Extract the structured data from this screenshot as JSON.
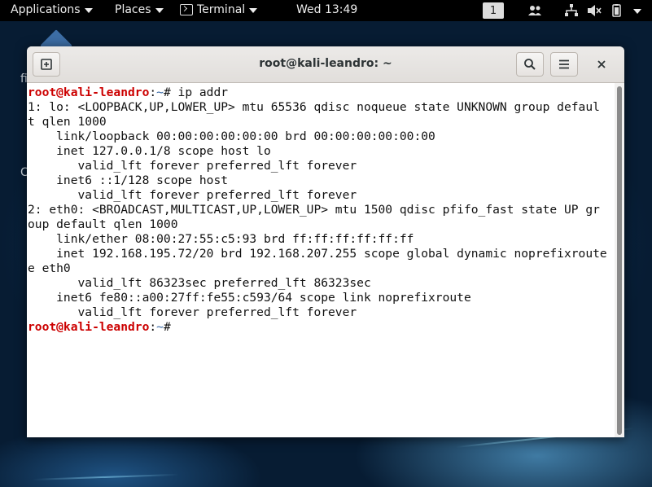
{
  "topbar": {
    "applications_label": "Applications",
    "places_label": "Places",
    "terminal_label": "Terminal",
    "clock": "Wed 13:49",
    "workspace_number": "1"
  },
  "window": {
    "title": "root@kali-leandro: ~"
  },
  "desktop": {
    "partial_text_1": "fi",
    "partial_text_2": "C"
  },
  "terminal": {
    "lines": [
      {
        "user": "root@kali-leandro",
        "sep": ":",
        "path": "~",
        "rest": "# ip addr"
      },
      {
        "text": "1: lo: <LOOPBACK,UP,LOWER_UP> mtu 65536 qdisc noqueue state UNKNOWN group defaul"
      },
      {
        "text": "t qlen 1000"
      },
      {
        "text": "    link/loopback 00:00:00:00:00:00 brd 00:00:00:00:00:00"
      },
      {
        "text": "    inet 127.0.0.1/8 scope host lo"
      },
      {
        "text": "       valid_lft forever preferred_lft forever"
      },
      {
        "text": "    inet6 ::1/128 scope host"
      },
      {
        "text": "       valid_lft forever preferred_lft forever"
      },
      {
        "text": "2: eth0: <BROADCAST,MULTICAST,UP,LOWER_UP> mtu 1500 qdisc pfifo_fast state UP gr"
      },
      {
        "text": "oup default qlen 1000"
      },
      {
        "text": "    link/ether 08:00:27:55:c5:93 brd ff:ff:ff:ff:ff:ff"
      },
      {
        "text": "    inet 192.168.195.72/20 brd 192.168.207.255 scope global dynamic noprefixroute"
      },
      {
        "text": "e eth0"
      },
      {
        "text": "       valid_lft 86323sec preferred_lft 86323sec"
      },
      {
        "text": "    inet6 fe80::a00:27ff:fe55:c593/64 scope link noprefixroute"
      },
      {
        "text": "       valid_lft forever preferred_lft forever"
      },
      {
        "user": "root@kali-leandro",
        "sep": ":",
        "path": "~",
        "rest": "#"
      }
    ]
  },
  "colors": {
    "prompt_user": "#cc0000",
    "prompt_path": "#3465a4",
    "topbar_bg": "#000000",
    "terminal_bg": "#ffffff"
  },
  "icons": {
    "new_tab": "new-tab-icon",
    "search": "search-icon",
    "menu": "hamburger-menu-icon",
    "close": "close-icon",
    "network": "network-icon",
    "volume": "volume-muted-icon",
    "battery": "battery-icon",
    "people": "people-icon"
  }
}
